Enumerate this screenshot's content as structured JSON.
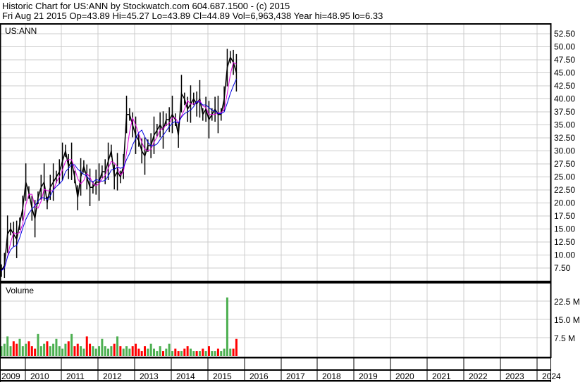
{
  "header": {
    "line1": "Historic Chart for US:ANN by Stockwatch.com 604.687.1500 - (c) 2015",
    "line2": "Fri Aug 21 2015  Op=43.89  Hi=45.27  Lo=43.89  Cl=44.89  Vol=6,963,438  Year hi=48.95  lo=6.33"
  },
  "chart_data": {
    "type": "line",
    "symbol": "US:ANN",
    "price_ylim": [
      5,
      55
    ],
    "price_ticks": [
      "52.50",
      "50.00",
      "47.50",
      "45.00",
      "42.50",
      "40.00",
      "37.50",
      "35.00",
      "32.50",
      "30.00",
      "27.50",
      "25.00",
      "22.50",
      "20.00",
      "17.50",
      "15.00",
      "12.50",
      "10.00",
      "7.50"
    ],
    "volume_label": "Volume",
    "volume_ticks": [
      "22.5 M",
      "15.0 M",
      "7.5 M"
    ],
    "years": [
      "2009",
      "2010",
      "2011",
      "2012",
      "2013",
      "2014",
      "2015",
      "2016",
      "2017",
      "2018",
      "2019",
      "2020",
      "2021",
      "2022",
      "2023",
      "2024"
    ],
    "start_month": "2009-03",
    "monthly_close": [
      7,
      8,
      14,
      15,
      14,
      13,
      16,
      19,
      24,
      22,
      19,
      17,
      21,
      23,
      24,
      20,
      23,
      24,
      25,
      26,
      28,
      30,
      27,
      28,
      25,
      21,
      25,
      27,
      25,
      23,
      23,
      24,
      24,
      26,
      26,
      28,
      30,
      25,
      26,
      25,
      27,
      37,
      37,
      35,
      33,
      32,
      30,
      29,
      31,
      31,
      33,
      34,
      35,
      34,
      36,
      36,
      37,
      36,
      33,
      41,
      40,
      38,
      39,
      40,
      39,
      40,
      37,
      38,
      36,
      37,
      38,
      37,
      37,
      40,
      46,
      48,
      47,
      45
    ],
    "monthly_volume_m": [
      4,
      5,
      8,
      4,
      6,
      5,
      7,
      4,
      5,
      6,
      4,
      3,
      9,
      4,
      5,
      6,
      4,
      5,
      7,
      4,
      3,
      5,
      6,
      9,
      4,
      5,
      4,
      3,
      8,
      5,
      4,
      3,
      4,
      7,
      4,
      3,
      4,
      5,
      8,
      4,
      3,
      4,
      3,
      4,
      5,
      3,
      2,
      4,
      3,
      5,
      3,
      2,
      4,
      2,
      3,
      5,
      2,
      3,
      2,
      2,
      3,
      4,
      3,
      2,
      2,
      2,
      3,
      2,
      4,
      2,
      2,
      3,
      2,
      3,
      24,
      3,
      3,
      7
    ],
    "moving_averages": [
      {
        "name": "short",
        "color": "#e000e0",
        "period": 2
      },
      {
        "name": "long",
        "color": "#0000e0",
        "period": 5
      }
    ],
    "up_color": "#4caf50",
    "down_color": "#ff0000"
  }
}
